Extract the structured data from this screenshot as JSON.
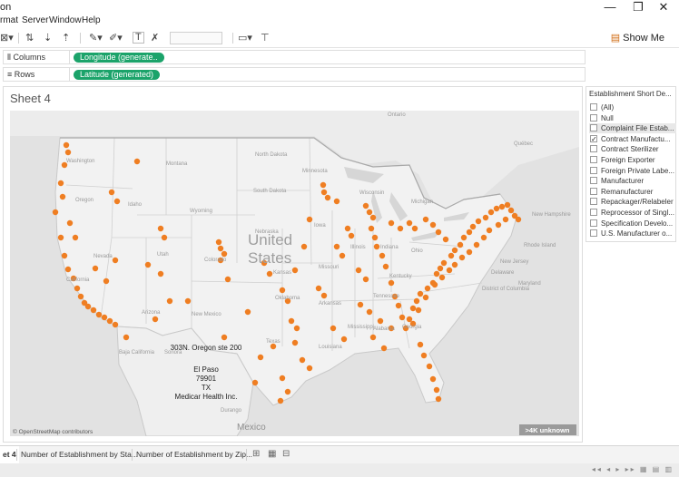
{
  "window": {
    "title_fragment": "on",
    "minimize": "—",
    "restore": "❐",
    "close": "✕"
  },
  "menu": [
    "rmat",
    "Server",
    "Window",
    "Help"
  ],
  "toolbar": {
    "show_me_label": "Show Me",
    "show_me_icon": "show-me-icon"
  },
  "shelves": {
    "columns": {
      "label": "Columns",
      "pill": "Longitude (generate.."
    },
    "rows": {
      "label": "Rows",
      "pill": "Latitude (generated)"
    }
  },
  "sheet": {
    "title": "Sheet 4"
  },
  "map": {
    "labels": {
      "united": "United",
      "states": "States",
      "mexico": "Mexico",
      "ontario": "Ontario",
      "quebec": "Québec",
      "washington": "Washington",
      "montana": "Montana",
      "north_dakota": "North\nDakota",
      "minnesota": "Minnesota",
      "oregon": "Oregon",
      "idaho": "Idaho",
      "wyoming": "Wyoming",
      "south_dakota": "South\nDakota",
      "nebraska": "Nebraska",
      "iowa": "Iowa",
      "wisconsin": "Wisconsin",
      "michigan": "Michigan",
      "nevada": "Nevada",
      "utah": "Utah",
      "colorado": "Colorado",
      "kansas": "Kansas",
      "missouri": "Missouri",
      "illinois": "Illinois",
      "indiana": "Indiana",
      "ohio": "Ohio",
      "california": "California",
      "arizona": "Arizona",
      "new_mexico": "New Mexico",
      "oklahoma": "Oklahoma",
      "arkansas": "Arkansas",
      "texas": "Texas",
      "louisiana": "Louisiana",
      "mississippi": "Mississippi",
      "alabama": "Alabama",
      "georgia": "Georgia",
      "tennessee": "Tennessee",
      "kentucky": "Kentucky",
      "new_hampshire": "New Hampshire",
      "rhode_island": "Rhode Island",
      "new_jersey": "New Jersey",
      "delaware": "Delaware",
      "maryland": "Maryland",
      "district_of_columbia": "District\nof Columbia",
      "baja_california": "Baja\nCalifornia",
      "sonora": "Sonora",
      "durango": "Durango"
    },
    "tooltip": [
      "303N. Oregon ste 200",
      "El Paso",
      "79901",
      "TX",
      "Medicar Health Inc."
    ],
    "attribution": "© OpenStreetMap contributors",
    "unknown_badge": ">4K unknown",
    "mark_color": "#ef7e22"
  },
  "legend": {
    "title": "Establishment Short De...",
    "items": [
      {
        "label": "(All)",
        "checked": false,
        "highlight": false
      },
      {
        "label": "Null",
        "checked": false,
        "highlight": false
      },
      {
        "label": "Complaint File Estab...",
        "checked": false,
        "highlight": true
      },
      {
        "label": "Contract Manufactu...",
        "checked": true,
        "highlight": false
      },
      {
        "label": "Contract Sterilizer",
        "checked": false,
        "highlight": false
      },
      {
        "label": "Foreign Exporter",
        "checked": false,
        "highlight": false
      },
      {
        "label": "Foreign Private Labe...",
        "checked": false,
        "highlight": false
      },
      {
        "label": "Manufacturer",
        "checked": false,
        "highlight": false
      },
      {
        "label": "Remanufacturer",
        "checked": false,
        "highlight": false
      },
      {
        "label": "Repackager/Relabeler",
        "checked": false,
        "highlight": false
      },
      {
        "label": "Reprocessor of Singl...",
        "checked": false,
        "highlight": false
      },
      {
        "label": "Specification Develo...",
        "checked": false,
        "highlight": false
      },
      {
        "label": "U.S. Manufacturer o...",
        "checked": false,
        "highlight": false
      }
    ]
  },
  "tabs": {
    "active": "et 4",
    "others": [
      "Number of Establishment by Sta...",
      "Number of Establishment by Zip..."
    ]
  }
}
